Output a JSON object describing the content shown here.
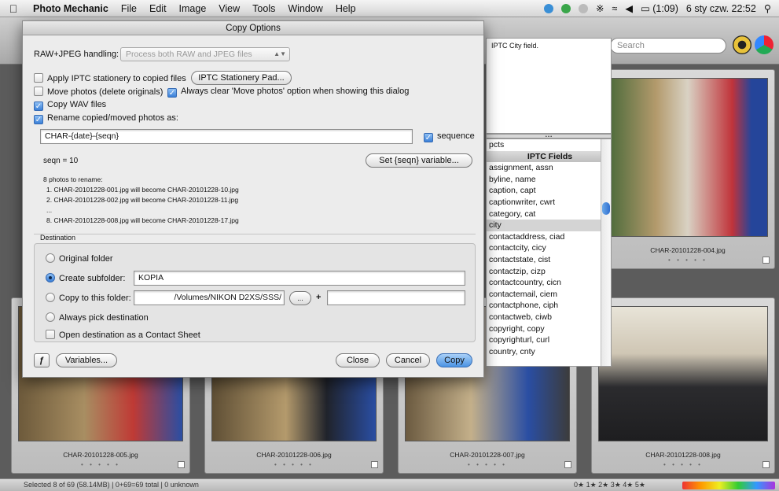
{
  "menubar": {
    "app_name": "Photo Mechanic",
    "items": [
      "File",
      "Edit",
      "Image",
      "View",
      "Tools",
      "Window",
      "Help"
    ],
    "battery": "(1:09)",
    "clock": "6 sty czw. 22:52"
  },
  "app": {
    "search_placeholder": "Search",
    "status_text": "Selected 8 of 69 (58.14MB) | 0+69=69 total | 0 unknown",
    "rating_filter": "0★ 1★ 2★ 3★ 4★ 5★",
    "thumbnails": [
      {
        "filename": "CHAR-20101228-004.jpg"
      },
      {
        "filename": "CHAR-20101228-005.jpg"
      },
      {
        "filename": "CHAR-20101228-006.jpg"
      },
      {
        "filename": "CHAR-20101228-007.jpg"
      },
      {
        "filename": "CHAR-20101228-008.jpg"
      }
    ]
  },
  "iptc_panel": {
    "top_text": "IPTC City field.",
    "list_first": "pcts",
    "header": "IPTC Fields",
    "fields": [
      "assignment, assn",
      "byline, name",
      "caption, capt",
      "captionwriter, cwrt",
      "category, cat",
      "city",
      "contactaddress, ciad",
      "contactcity, cicy",
      "contactstate, cist",
      "contactzip, cizp",
      "contactcountry, cicn",
      "contactemail, ciem",
      "contactphone, ciph",
      "contactweb, ciwb",
      "copyright, copy",
      "copyrighturl, curl",
      "country, cnty"
    ],
    "selected": "city"
  },
  "dialog": {
    "title": "Copy Options",
    "raw_label": "RAW+JPEG handling:",
    "raw_value": "Process both RAW and JPEG files",
    "apply_iptc_label": "Apply IPTC stationery to copied files",
    "iptc_pad_button": "IPTC Stationery Pad...",
    "move_photos_label": "Move photos (delete originals)",
    "always_clear_label": "Always clear 'Move photos' option when showing this dialog",
    "copy_wav_label": "Copy WAV files",
    "rename_label": "Rename copied/moved photos as:",
    "rename_value": "CHAR-{date}-{seqn}",
    "sequence_label": "sequence",
    "seqn_text": "seqn = 10",
    "set_seqn_button": "Set {seqn} variable...",
    "rename_count": "8 photos to rename:",
    "rename_examples": [
      "1.  CHAR-20101228-001.jpg will become CHAR-20101228-10.jpg",
      "2.  CHAR-20101228-002.jpg will become CHAR-20101228-11.jpg",
      "...",
      "8.  CHAR-20101228-008.jpg will become CHAR-20101228-17.jpg"
    ],
    "destination_label": "Destination",
    "original_folder_label": "Original folder",
    "create_subfolder_label": "Create subfolder:",
    "subfolder_value": "KOPIA",
    "copy_to_folder_label": "Copy to this folder:",
    "folder_path": "/Volumes/NIKON D2XS/SSS/",
    "browse_button": "...",
    "plus": "+",
    "always_pick_label": "Always pick destination",
    "contact_sheet_label": "Open destination as a Contact Sheet",
    "variables_button": "Variables...",
    "close_button": "Close",
    "cancel_button": "Cancel",
    "copy_button": "Copy",
    "checkmark": "✓"
  }
}
